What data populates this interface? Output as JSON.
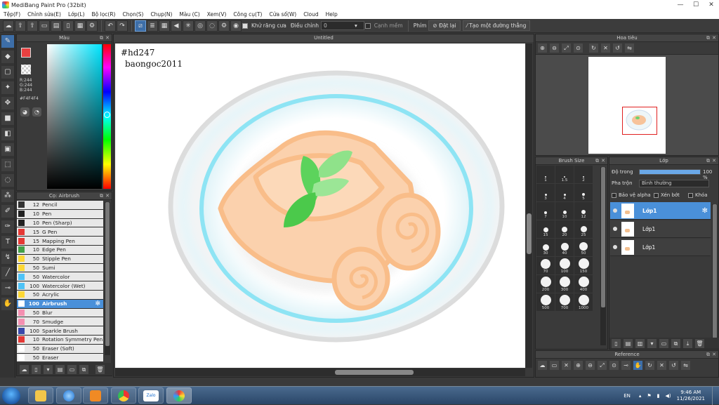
{
  "window": {
    "title": "MediBang Paint Pro (32bit)"
  },
  "menu": [
    "Tệp(F)",
    "Chỉnh sửa(E)",
    "Lớp(L)",
    "Bộ lọc(R)",
    "Chọn(S)",
    "Chụp(N)",
    "Màu (C)",
    "Xem(V)",
    "Công cụ(T)",
    "Cửa số(W)",
    "Cloud",
    "Help"
  ],
  "toolbar": {
    "antialias_label": "Khử răng cưa",
    "adjust_label": "Điều chỉnh",
    "adjust_value": "0",
    "soft_edge_label": "Cạnh mềm",
    "key_label": "Phím",
    "reset_label": "Đặt lại",
    "create_line_label": "Tạo một đường thẳng"
  },
  "color_panel": {
    "title": "Màu",
    "r": "R:244",
    "g": "G:244",
    "b": "B:244",
    "hex": "#F4F4F4",
    "fg_color": "#e84040",
    "bg_color": "#f4f4f4"
  },
  "brush_panel": {
    "title": "Cọ: Airbrush",
    "brushes": [
      {
        "size": "12",
        "name": "Pencil",
        "color": "#333333"
      },
      {
        "size": "10",
        "name": "Pen",
        "color": "#222222"
      },
      {
        "size": "10",
        "name": "Pen (Sharp)",
        "color": "#222222"
      },
      {
        "size": "15",
        "name": "G Pen",
        "color": "#e53935"
      },
      {
        "size": "15",
        "name": "Mapping Pen",
        "color": "#e53935"
      },
      {
        "size": "10",
        "name": "Edge Pen",
        "color": "#43a047"
      },
      {
        "size": "50",
        "name": "Stipple Pen",
        "color": "#fdd835"
      },
      {
        "size": "50",
        "name": "Sumi",
        "color": "#fdd835"
      },
      {
        "size": "50",
        "name": "Watercolor",
        "color": "#4fc3f7"
      },
      {
        "size": "100",
        "name": "Watercolor (Wet)",
        "color": "#4fc3f7"
      },
      {
        "size": "50",
        "name": "Acrylic",
        "color": "#fdd835"
      },
      {
        "size": "100",
        "name": "Airbrush",
        "color": "#ffffff",
        "selected": true
      },
      {
        "size": "50",
        "name": "Blur",
        "color": "#f48fb1"
      },
      {
        "size": "70",
        "name": "Smudge",
        "color": "#f48fb1"
      },
      {
        "size": "100",
        "name": "Sparkle Brush",
        "color": "#3949ab"
      },
      {
        "size": "10",
        "name": "Rotation Symmetry Pen",
        "color": "#e53935"
      },
      {
        "size": "50",
        "name": "Eraser (Soft)",
        "color": "#ffffff"
      },
      {
        "size": "50",
        "name": "Eraser",
        "color": "#ffffff"
      }
    ]
  },
  "canvas": {
    "title": "Untitled",
    "text_line1": "#hd247",
    "text_line2": "baongoc2011"
  },
  "navigator": {
    "title": "Hoa tiêu"
  },
  "brush_size": {
    "title": "Brush Size",
    "sizes": [
      "1",
      "1.5",
      "2",
      "3",
      "4",
      "5",
      "7",
      "10",
      "12",
      "15",
      "20",
      "25",
      "30",
      "40",
      "50",
      "70",
      "100",
      "150",
      "200",
      "300",
      "400",
      "500",
      "700",
      "1000"
    ]
  },
  "layer_panel": {
    "title": "Lớp",
    "opacity_label": "Độ trong",
    "opacity_value": "100 %",
    "opacity": 1.0,
    "blend_label": "Pha trộn",
    "blend_value": "Bình thường",
    "protect_alpha": "Bảo vệ alpha",
    "clipping": "Xén bớt",
    "lock": "Khóa",
    "layers": [
      {
        "name": "Lớp1",
        "selected": true
      },
      {
        "name": "Lớp1",
        "selected": false
      },
      {
        "name": "Lớp1",
        "selected": false
      }
    ]
  },
  "reference": {
    "title": "Reference"
  },
  "taskbar": {
    "language": "EN",
    "time": "9:46 AM",
    "date": "11/26/2021",
    "zalo_label": "Zalo"
  }
}
